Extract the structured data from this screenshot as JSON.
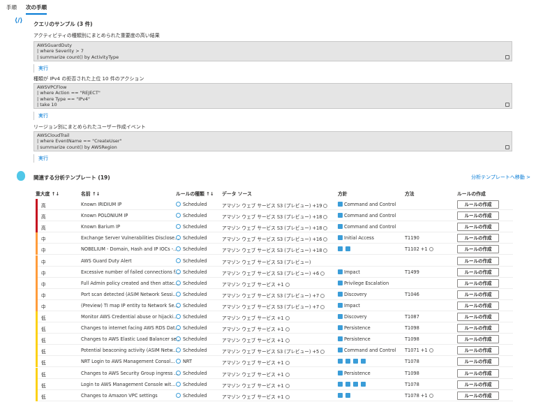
{
  "tabs": [
    {
      "label": "手順"
    },
    {
      "label": "次の手順"
    }
  ],
  "queries": {
    "title": "クエリのサンプル (3 件)",
    "run_label": "実行",
    "items": [
      {
        "label": "アクティビティの種類別にまとめられた重要度の高い結果",
        "lines": [
          "AWSGuardDuty",
          "| where Severity > 7",
          "| summarize count() by ActivityType"
        ]
      },
      {
        "label": "種類が IPv4 の拒否された上位 10 件のアクション",
        "lines": [
          "AWSVPCFlow",
          "| where Action == \"REJECT\"",
          "| where Type == \"IPv4\"",
          "| take 10"
        ]
      },
      {
        "label": "リージョン別にまとめられたユーザー作成イベント",
        "lines": [
          "AWSCloudTrail",
          "| where EventName == \"CreateUser\"",
          "| summarize count() by AWSRegion"
        ]
      }
    ]
  },
  "templates": {
    "title": "関連する分析テンプレート (19)",
    "link": "分析テンプレートへ移動 >",
    "headers": {
      "severity": "重大度 ↑↓",
      "name": "名前 ↑↓",
      "type": "ルールの種類 ↑↓",
      "source": "データ ソース",
      "tactics": "方針",
      "technique": "方法",
      "create": "ルールの作成"
    },
    "button_label": "ルールの作成",
    "severity_colors": {
      "高": "#c50f1f",
      "中": "#ff9c3b",
      "低": "#fcd116"
    },
    "rows": [
      {
        "sev": "高",
        "name": "Known IRIDIUM IP",
        "type": "Scheduled",
        "source": "アマゾン ウェブ サービス S3 (プレビュー) +19",
        "tactic": "Command and Control",
        "technique": ""
      },
      {
        "sev": "高",
        "name": "Known POLONIUM IP",
        "type": "Scheduled",
        "source": "アマゾン ウェブ サービス S3 (プレビュー) +18",
        "tactic": "Command and Control",
        "technique": ""
      },
      {
        "sev": "高",
        "name": "Known Barium IP",
        "type": "Scheduled",
        "source": "アマゾン ウェブ サービス S3 (プレビュー) +18",
        "tactic": "Command and Control",
        "technique": ""
      },
      {
        "sev": "中",
        "name": "Exchange Server Vulnerabilities Disclose...",
        "type": "Scheduled",
        "source": "アマゾン ウェブ サービス S3 (プレビュー) +16",
        "tactic": "Initial Access",
        "technique": "T1190"
      },
      {
        "sev": "中",
        "name": "NOBELIUM - Domain, Hash and IP IOCs -...",
        "type": "Scheduled",
        "source": "アマゾン ウェブ サービス S3 (プレビュー) +18",
        "tactic": "",
        "icons": 2,
        "technique": "T1102 +1"
      },
      {
        "sev": "中",
        "name": "AWS Guard Duty Alert",
        "type": "Scheduled",
        "source": "アマゾン ウェブ サービス S3 (プレビュー)",
        "tactic": "",
        "technique": ""
      },
      {
        "sev": "中",
        "name": "Excessive number of failed connections f...",
        "type": "Scheduled",
        "source": "アマゾン ウェブ サービス S3 (プレビュー) +6",
        "tactic": "Impact",
        "technique": "T1499"
      },
      {
        "sev": "中",
        "name": "Full Admin policy created and then attac...",
        "type": "Scheduled",
        "source": "アマゾン ウェブ サービス +1",
        "tactic": "Privilege Escalation",
        "technique": ""
      },
      {
        "sev": "中",
        "name": "Port scan detected (ASIM Network Sessi...",
        "type": "Scheduled",
        "source": "アマゾン ウェブ サービス S3 (プレビュー) +7",
        "tactic": "Discovery",
        "technique": "T1046"
      },
      {
        "sev": "中",
        "name": "(Preview) TI map IP entity to Network Se...",
        "type": "Scheduled",
        "source": "アマゾン ウェブ サービス S3 (プレビュー) +7",
        "tactic": "Impact",
        "technique": ""
      },
      {
        "sev": "低",
        "name": "Monitor AWS Credential abuse or hijacki...",
        "type": "Scheduled",
        "source": "アマゾン ウェブ サービス +1",
        "tactic": "Discovery",
        "technique": "T1087"
      },
      {
        "sev": "低",
        "name": "Changes to internet facing AWS RDS Dat...",
        "type": "Scheduled",
        "source": "アマゾン ウェブ サービス +1",
        "tactic": "Persistence",
        "technique": "T1098"
      },
      {
        "sev": "低",
        "name": "Changes to AWS Elastic Load Balancer se...",
        "type": "Scheduled",
        "source": "アマゾン ウェブ サービス +1",
        "tactic": "Persistence",
        "technique": "T1098"
      },
      {
        "sev": "低",
        "name": "Potential beaconing activity (ASIM Netw...",
        "type": "Scheduled",
        "source": "アマゾン ウェブ サービス S3 (プレビュー) +5",
        "tactic": "Command and Control",
        "technique": "T1071 +1"
      },
      {
        "sev": "低",
        "name": "NRT Login to AWS Management Consol...",
        "type": "NRT",
        "source": "アマゾン ウェブ サービス +1",
        "tactic": "",
        "icons": 4,
        "technique": "T1078"
      },
      {
        "sev": "低",
        "name": "Changes to AWS Security Group ingress ...",
        "type": "Scheduled",
        "source": "アマゾン ウェブ サービス +1",
        "tactic": "Persistence",
        "technique": "T1098"
      },
      {
        "sev": "低",
        "name": "Login to AWS Management Console wit...",
        "type": "Scheduled",
        "source": "アマゾン ウェブ サービス +1",
        "tactic": "",
        "icons": 4,
        "technique": "T1078"
      },
      {
        "sev": "低",
        "name": "Changes to Amazon VPC settings",
        "type": "Scheduled",
        "source": "アマゾン ウェブ サービス +1",
        "tactic": "",
        "icons": 2,
        "technique": "T1078 +1"
      }
    ]
  }
}
